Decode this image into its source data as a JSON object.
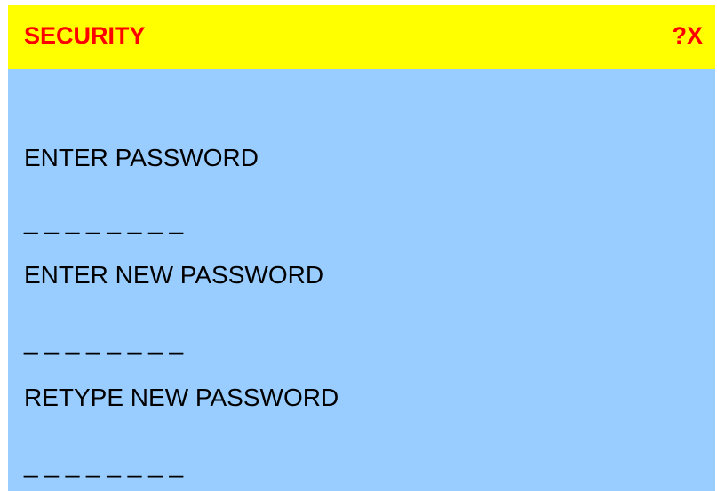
{
  "dialog": {
    "title": "SECURITY",
    "help_label": "?",
    "close_label": "X",
    "colors": {
      "title_bar": "#ffff00",
      "title_text": "#ff0000",
      "body": "#99ccff"
    }
  },
  "form": {
    "current_password_label": "ENTER PASSWORD",
    "current_password_value": "_ _ _ _ _ _ _ _",
    "new_password_label": "ENTER NEW PASSWORD",
    "new_password_value": "_ _ _ _ _ _ _ _",
    "retype_password_label": "RETYPE NEW PASSWORD",
    "retype_password_value": "_ _ _ _ _ _ _ _"
  }
}
